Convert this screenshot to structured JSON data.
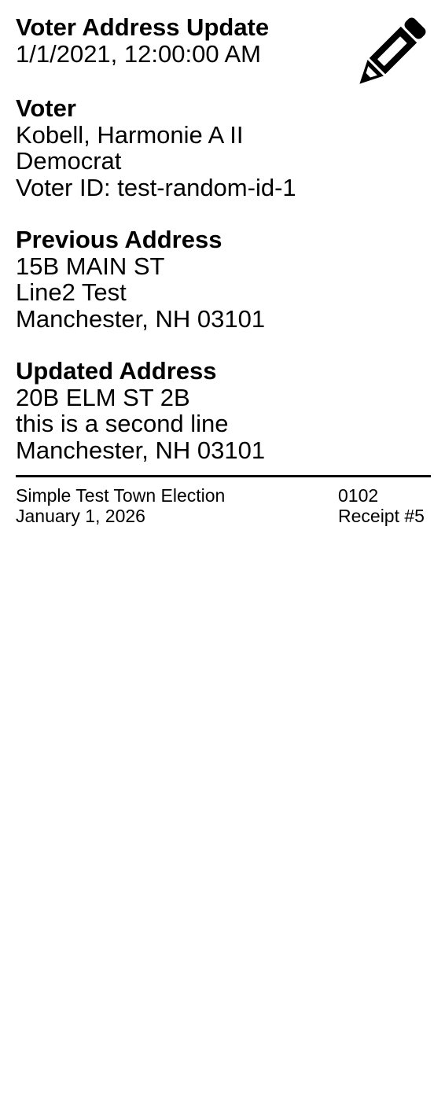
{
  "header": {
    "title": "Voter Address Update",
    "timestamp": "1/1/2021, 12:00:00 AM",
    "icon": "pencil-icon"
  },
  "voter": {
    "heading": "Voter",
    "name": "Kobell, Harmonie A II",
    "party": "Democrat",
    "voter_id": "Voter ID: test-random-id-1"
  },
  "previous_address": {
    "heading": "Previous Address",
    "line1": "15B MAIN ST",
    "line2": "Line2 Test",
    "city_state_zip": "Manchester, NH 03101"
  },
  "updated_address": {
    "heading": "Updated Address",
    "line1": "20B ELM ST 2B",
    "line2": "this is a second line",
    "city_state_zip": "Manchester, NH 03101"
  },
  "footer": {
    "election_name": "Simple Test Town Election",
    "election_date": "January 1, 2026",
    "code": "0102",
    "receipt_number": "Receipt #5"
  }
}
